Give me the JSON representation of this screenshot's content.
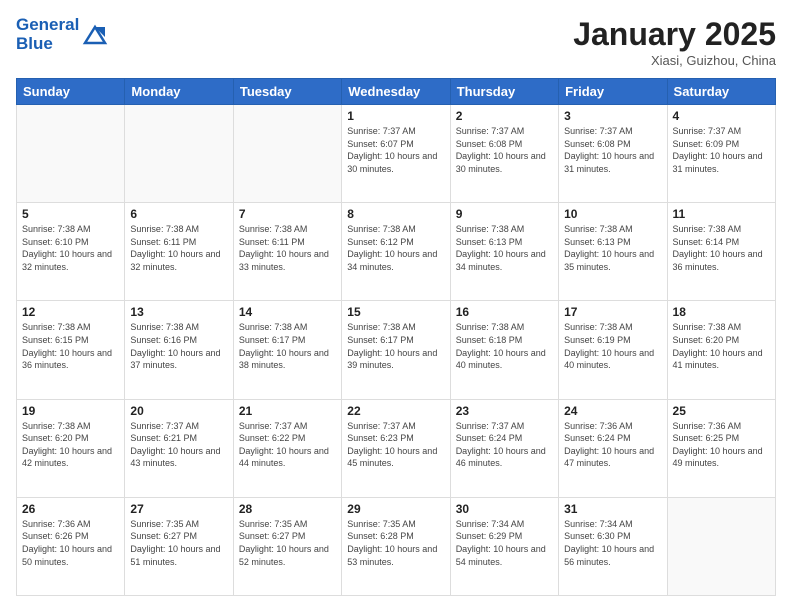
{
  "header": {
    "logo_general": "General",
    "logo_blue": "Blue",
    "month_title": "January 2025",
    "location": "Xiasi, Guizhou, China"
  },
  "weekdays": [
    "Sunday",
    "Monday",
    "Tuesday",
    "Wednesday",
    "Thursday",
    "Friday",
    "Saturday"
  ],
  "weeks": [
    [
      {
        "day": "",
        "info": ""
      },
      {
        "day": "",
        "info": ""
      },
      {
        "day": "",
        "info": ""
      },
      {
        "day": "1",
        "info": "Sunrise: 7:37 AM\nSunset: 6:07 PM\nDaylight: 10 hours and 30 minutes."
      },
      {
        "day": "2",
        "info": "Sunrise: 7:37 AM\nSunset: 6:08 PM\nDaylight: 10 hours and 30 minutes."
      },
      {
        "day": "3",
        "info": "Sunrise: 7:37 AM\nSunset: 6:08 PM\nDaylight: 10 hours and 31 minutes."
      },
      {
        "day": "4",
        "info": "Sunrise: 7:37 AM\nSunset: 6:09 PM\nDaylight: 10 hours and 31 minutes."
      }
    ],
    [
      {
        "day": "5",
        "info": "Sunrise: 7:38 AM\nSunset: 6:10 PM\nDaylight: 10 hours and 32 minutes."
      },
      {
        "day": "6",
        "info": "Sunrise: 7:38 AM\nSunset: 6:11 PM\nDaylight: 10 hours and 32 minutes."
      },
      {
        "day": "7",
        "info": "Sunrise: 7:38 AM\nSunset: 6:11 PM\nDaylight: 10 hours and 33 minutes."
      },
      {
        "day": "8",
        "info": "Sunrise: 7:38 AM\nSunset: 6:12 PM\nDaylight: 10 hours and 34 minutes."
      },
      {
        "day": "9",
        "info": "Sunrise: 7:38 AM\nSunset: 6:13 PM\nDaylight: 10 hours and 34 minutes."
      },
      {
        "day": "10",
        "info": "Sunrise: 7:38 AM\nSunset: 6:13 PM\nDaylight: 10 hours and 35 minutes."
      },
      {
        "day": "11",
        "info": "Sunrise: 7:38 AM\nSunset: 6:14 PM\nDaylight: 10 hours and 36 minutes."
      }
    ],
    [
      {
        "day": "12",
        "info": "Sunrise: 7:38 AM\nSunset: 6:15 PM\nDaylight: 10 hours and 36 minutes."
      },
      {
        "day": "13",
        "info": "Sunrise: 7:38 AM\nSunset: 6:16 PM\nDaylight: 10 hours and 37 minutes."
      },
      {
        "day": "14",
        "info": "Sunrise: 7:38 AM\nSunset: 6:17 PM\nDaylight: 10 hours and 38 minutes."
      },
      {
        "day": "15",
        "info": "Sunrise: 7:38 AM\nSunset: 6:17 PM\nDaylight: 10 hours and 39 minutes."
      },
      {
        "day": "16",
        "info": "Sunrise: 7:38 AM\nSunset: 6:18 PM\nDaylight: 10 hours and 40 minutes."
      },
      {
        "day": "17",
        "info": "Sunrise: 7:38 AM\nSunset: 6:19 PM\nDaylight: 10 hours and 40 minutes."
      },
      {
        "day": "18",
        "info": "Sunrise: 7:38 AM\nSunset: 6:20 PM\nDaylight: 10 hours and 41 minutes."
      }
    ],
    [
      {
        "day": "19",
        "info": "Sunrise: 7:38 AM\nSunset: 6:20 PM\nDaylight: 10 hours and 42 minutes."
      },
      {
        "day": "20",
        "info": "Sunrise: 7:37 AM\nSunset: 6:21 PM\nDaylight: 10 hours and 43 minutes."
      },
      {
        "day": "21",
        "info": "Sunrise: 7:37 AM\nSunset: 6:22 PM\nDaylight: 10 hours and 44 minutes."
      },
      {
        "day": "22",
        "info": "Sunrise: 7:37 AM\nSunset: 6:23 PM\nDaylight: 10 hours and 45 minutes."
      },
      {
        "day": "23",
        "info": "Sunrise: 7:37 AM\nSunset: 6:24 PM\nDaylight: 10 hours and 46 minutes."
      },
      {
        "day": "24",
        "info": "Sunrise: 7:36 AM\nSunset: 6:24 PM\nDaylight: 10 hours and 47 minutes."
      },
      {
        "day": "25",
        "info": "Sunrise: 7:36 AM\nSunset: 6:25 PM\nDaylight: 10 hours and 49 minutes."
      }
    ],
    [
      {
        "day": "26",
        "info": "Sunrise: 7:36 AM\nSunset: 6:26 PM\nDaylight: 10 hours and 50 minutes."
      },
      {
        "day": "27",
        "info": "Sunrise: 7:35 AM\nSunset: 6:27 PM\nDaylight: 10 hours and 51 minutes."
      },
      {
        "day": "28",
        "info": "Sunrise: 7:35 AM\nSunset: 6:27 PM\nDaylight: 10 hours and 52 minutes."
      },
      {
        "day": "29",
        "info": "Sunrise: 7:35 AM\nSunset: 6:28 PM\nDaylight: 10 hours and 53 minutes."
      },
      {
        "day": "30",
        "info": "Sunrise: 7:34 AM\nSunset: 6:29 PM\nDaylight: 10 hours and 54 minutes."
      },
      {
        "day": "31",
        "info": "Sunrise: 7:34 AM\nSunset: 6:30 PM\nDaylight: 10 hours and 56 minutes."
      },
      {
        "day": "",
        "info": ""
      }
    ]
  ],
  "accent_color": "#2e6cc7"
}
